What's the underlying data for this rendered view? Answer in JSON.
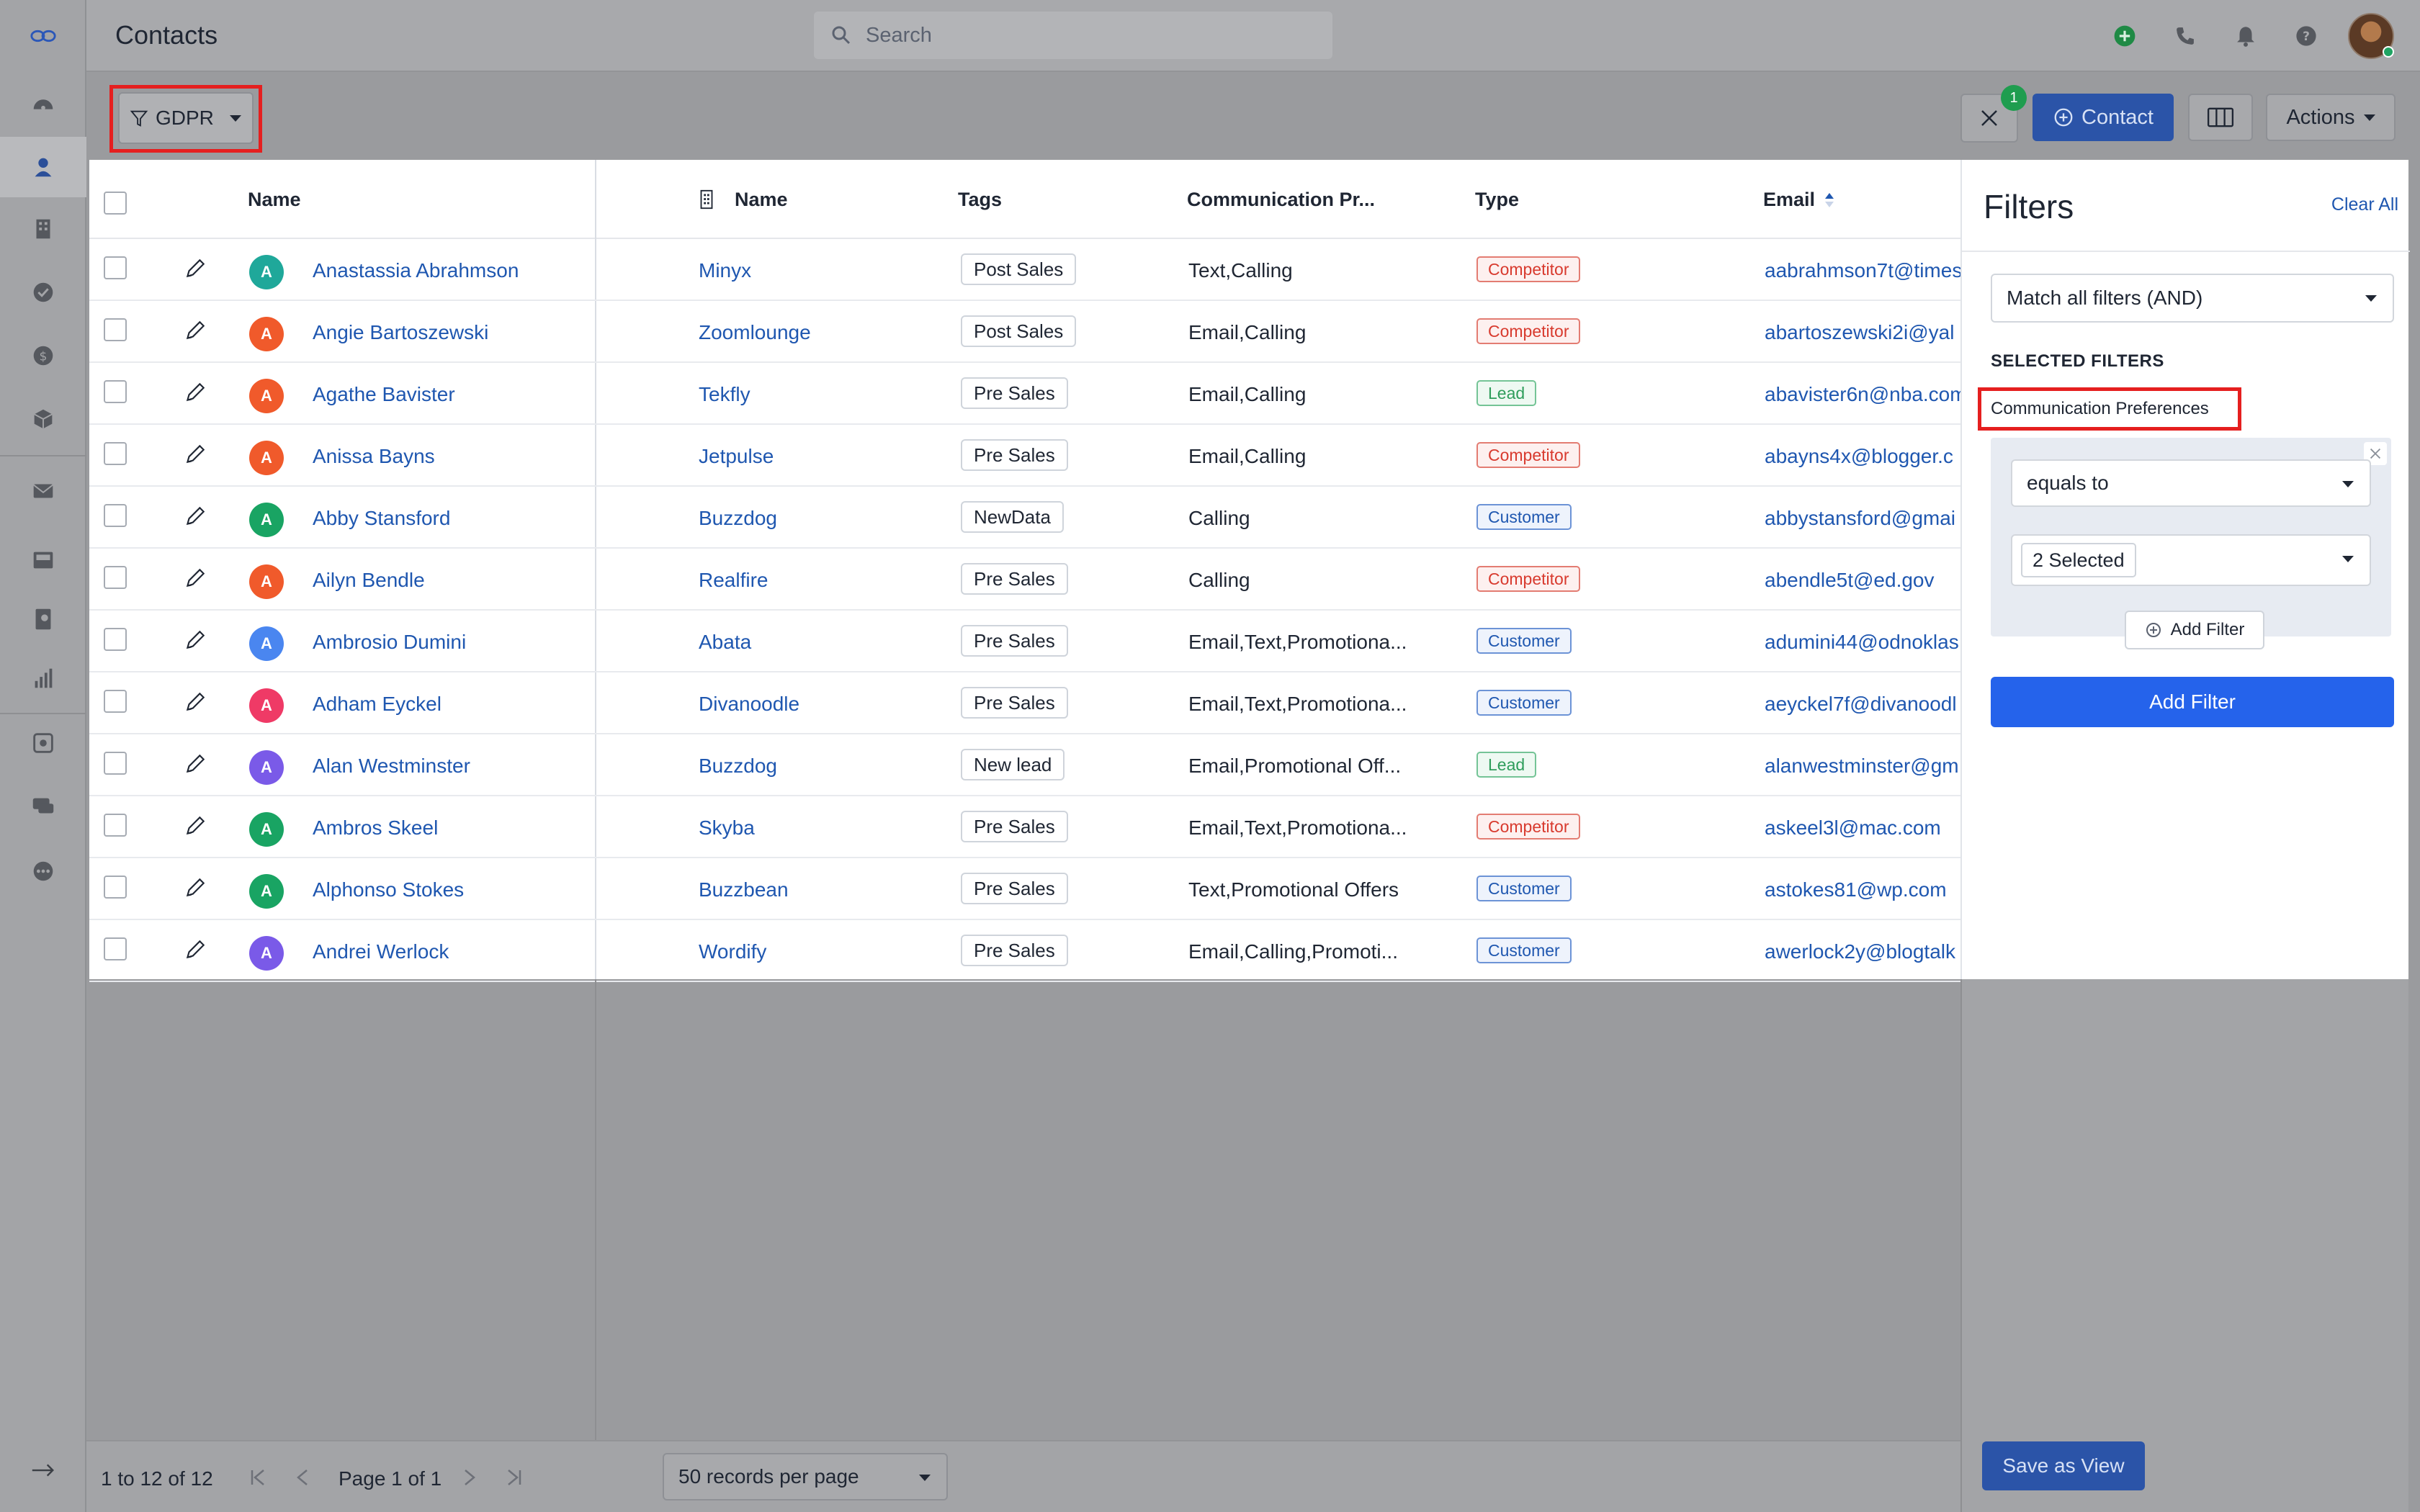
{
  "header": {
    "title": "Contacts",
    "search_placeholder": "Search"
  },
  "toolbar": {
    "filter_label": "GDPR",
    "filter_count_badge": "1",
    "add_contact_label": "Contact",
    "actions_label": "Actions"
  },
  "table": {
    "columns": {
      "contact_name": "Name",
      "company_name": "Name",
      "tags": "Tags",
      "comm_pref": "Communication Pr...",
      "type": "Type",
      "email": "Email"
    },
    "rows": [
      {
        "initial": "A",
        "avatar_color": "#1fa89a",
        "name": "Anastassia Abrahmson",
        "company": "Minyx",
        "tag": "Post Sales",
        "comm": "Text,Calling",
        "type": "Competitor",
        "email": "aabrahmson7t@times"
      },
      {
        "initial": "A",
        "avatar_color": "#f05a2b",
        "name": "Angie Bartoszewski",
        "company": "Zoomlounge",
        "tag": "Post Sales",
        "comm": "Email,Calling",
        "type": "Competitor",
        "email": "abartoszewski2i@yal"
      },
      {
        "initial": "A",
        "avatar_color": "#f05a2b",
        "name": "Agathe Bavister",
        "company": "Tekfly",
        "tag": "Pre Sales",
        "comm": "Email,Calling",
        "type": "Lead",
        "email": "abavister6n@nba.com"
      },
      {
        "initial": "A",
        "avatar_color": "#f05a2b",
        "name": "Anissa Bayns",
        "company": "Jetpulse",
        "tag": "Pre Sales",
        "comm": "Email,Calling",
        "type": "Competitor",
        "email": "abayns4x@blogger.c"
      },
      {
        "initial": "A",
        "avatar_color": "#19a463",
        "name": "Abby Stansford",
        "company": "Buzzdog",
        "tag": "NewData",
        "comm": "Calling",
        "type": "Customer",
        "email": "abbystansford@gmai"
      },
      {
        "initial": "A",
        "avatar_color": "#f05a2b",
        "name": "Ailyn Bendle",
        "company": "Realfire",
        "tag": "Pre Sales",
        "comm": "Calling",
        "type": "Competitor",
        "email": "abendle5t@ed.gov"
      },
      {
        "initial": "A",
        "avatar_color": "#4a86f0",
        "name": "Ambrosio Dumini",
        "company": "Abata",
        "tag": "Pre Sales",
        "comm": "Email,Text,Promotiona...",
        "type": "Customer",
        "email": "adumini44@odnoklas"
      },
      {
        "initial": "A",
        "avatar_color": "#ef3a66",
        "name": "Adham Eyckel",
        "company": "Divanoodle",
        "tag": "Pre Sales",
        "comm": "Email,Text,Promotiona...",
        "type": "Customer",
        "email": "aeyckel7f@divanoodl"
      },
      {
        "initial": "A",
        "avatar_color": "#7a5ae8",
        "name": "Alan Westminster",
        "company": "Buzzdog",
        "tag": "New lead",
        "comm": "Email,Promotional Off...",
        "type": "Lead",
        "email": "alanwestminster@gm"
      },
      {
        "initial": "A",
        "avatar_color": "#19a463",
        "name": "Ambros Skeel",
        "company": "Skyba",
        "tag": "Pre Sales",
        "comm": "Email,Text,Promotiona...",
        "type": "Competitor",
        "email": "askeel3l@mac.com"
      },
      {
        "initial": "A",
        "avatar_color": "#19a463",
        "name": "Alphonso Stokes",
        "company": "Buzzbean",
        "tag": "Pre Sales",
        "comm": "Text,Promotional Offers",
        "type": "Customer",
        "email": "astokes81@wp.com"
      },
      {
        "initial": "A",
        "avatar_color": "#7a5ae8",
        "name": "Andrei Werlock",
        "company": "Wordify",
        "tag": "Pre Sales",
        "comm": "Email,Calling,Promoti...",
        "type": "Customer",
        "email": "awerlock2y@blogtalk"
      }
    ]
  },
  "footer": {
    "range": "1 to 12 of 12",
    "page": "Page 1 of 1",
    "records_per_page": "50 records per page"
  },
  "filters": {
    "title": "Filters",
    "clear_all": "Clear All",
    "match_mode": "Match all filters (AND)",
    "selected_heading": "SELECTED FILTERS",
    "field": "Communication Preferences",
    "operator": "equals to",
    "value": "2 Selected",
    "add_filter_small": "Add Filter",
    "add_filter_big": "Add Filter",
    "save_view": "Save as View"
  },
  "colors": {
    "accent": "#2563eb",
    "highlight": "#e51f1f"
  }
}
